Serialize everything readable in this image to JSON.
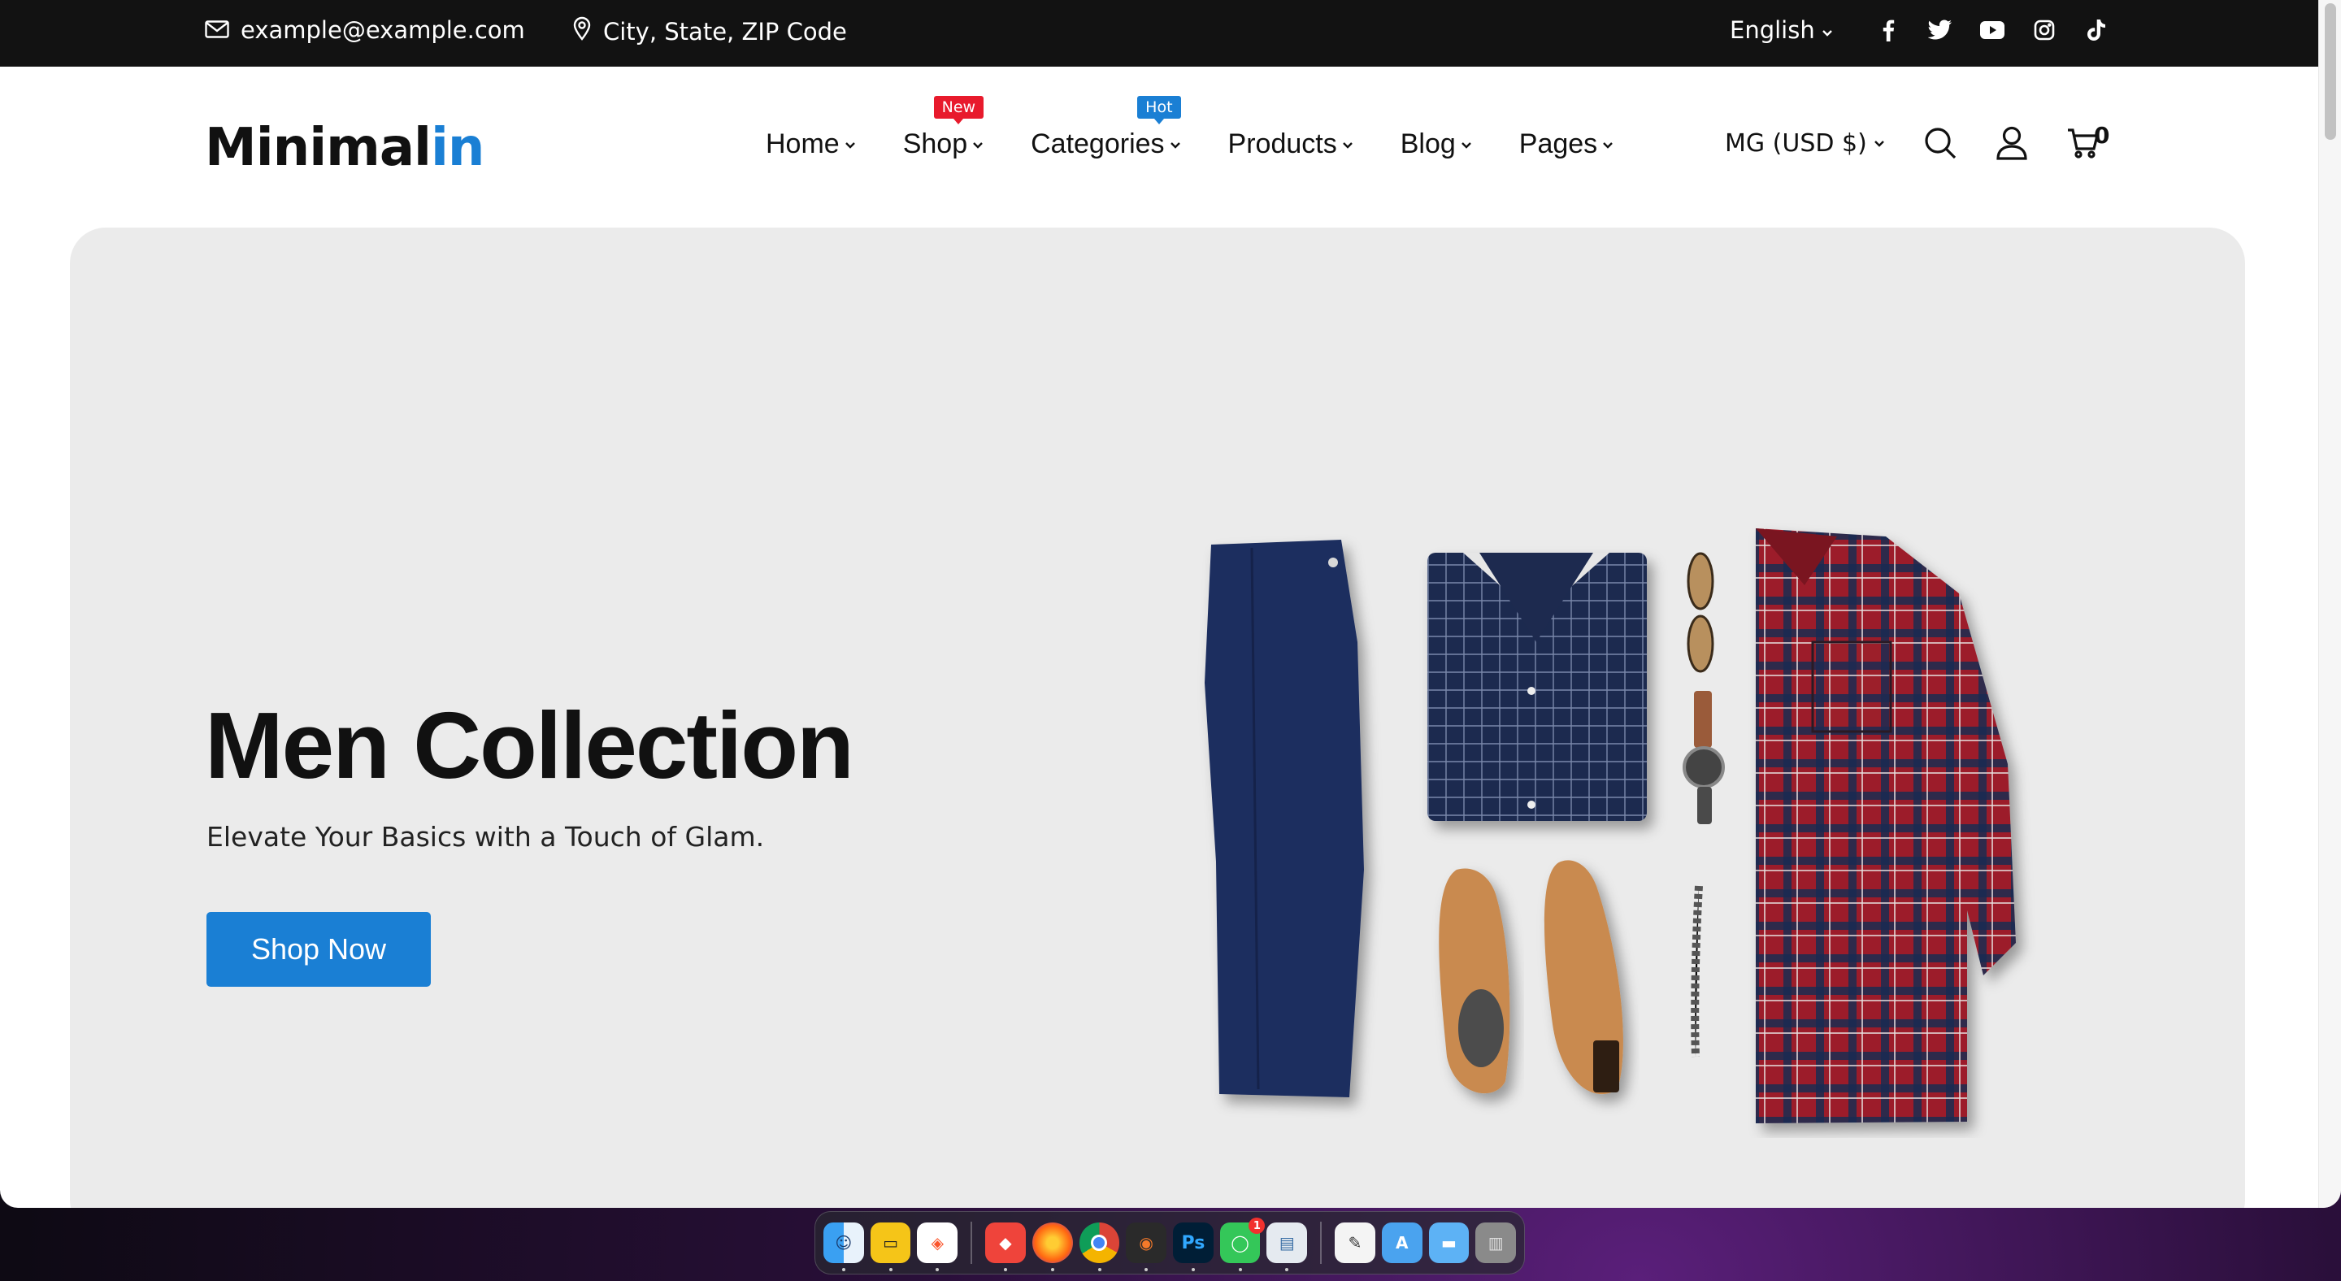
{
  "topbar": {
    "email": "example@example.com",
    "address": "City, State, ZIP Code",
    "language": "English",
    "social": [
      "facebook-icon",
      "twitter-icon",
      "youtube-icon",
      "instagram-icon",
      "tiktok-icon"
    ]
  },
  "header": {
    "logo_main": "Minimal",
    "logo_accent": "in",
    "nav": [
      {
        "label": "Home"
      },
      {
        "label": "Shop",
        "badge": "New"
      },
      {
        "label": "Categories",
        "badge": "Hot"
      },
      {
        "label": "Products"
      },
      {
        "label": "Blog"
      },
      {
        "label": "Pages"
      }
    ],
    "currency": "MG (USD $)",
    "cart_count": "0"
  },
  "hero": {
    "title": "Men Collection",
    "subtitle": "Elevate Your Basics with a Touch of Glam.",
    "cta": "Shop Now"
  },
  "colors": {
    "accent": "#1a7fd4",
    "badge_new": "#e81a2c",
    "topbar_bg": "#121212",
    "hero_bg": "#ebebeb"
  },
  "dock": {
    "apps": [
      {
        "name": "finder-icon",
        "badge": ""
      },
      {
        "name": "notes-app-icon",
        "badge": ""
      },
      {
        "name": "brave-browser-icon",
        "badge": ""
      },
      {
        "name": "anydesk-icon",
        "badge": ""
      },
      {
        "name": "firefox-icon",
        "badge": ""
      },
      {
        "name": "chrome-icon",
        "badge": ""
      },
      {
        "name": "blender-icon",
        "badge": ""
      },
      {
        "name": "photoshop-icon",
        "badge": ""
      },
      {
        "name": "messages-icon",
        "badge": "1"
      },
      {
        "name": "preview-icon",
        "badge": ""
      },
      {
        "name": "textedit-icon",
        "badge": ""
      },
      {
        "name": "app-store-folder-icon",
        "badge": ""
      },
      {
        "name": "folder-icon",
        "badge": ""
      },
      {
        "name": "trash-icon",
        "badge": ""
      }
    ]
  }
}
